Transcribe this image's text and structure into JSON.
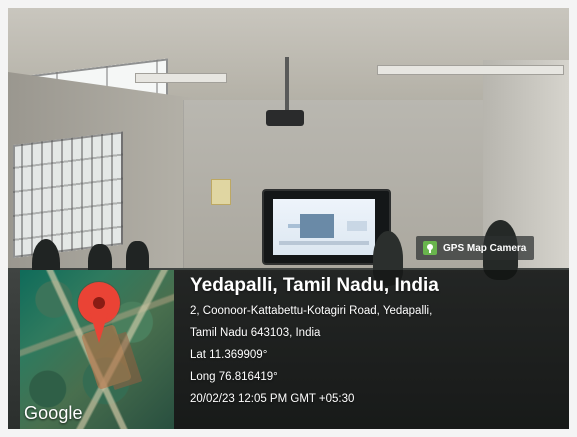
{
  "camera_badge": {
    "icon": "map-camera-icon",
    "label": "GPS Map Camera"
  },
  "map": {
    "pin_icon": "map-pin-icon",
    "provider": "Google"
  },
  "location": {
    "title": "Yedapalli, Tamil Nadu, India",
    "address_line_1": "2, Coonoor-Kattabettu-Kotagiri Road, Yedapalli,",
    "address_line_2": "Tamil Nadu 643103, India",
    "latitude": "Lat 11.369909°",
    "longitude": "Long 76.816419°",
    "timestamp": "20/02/23 12:05 PM GMT +05:30"
  }
}
